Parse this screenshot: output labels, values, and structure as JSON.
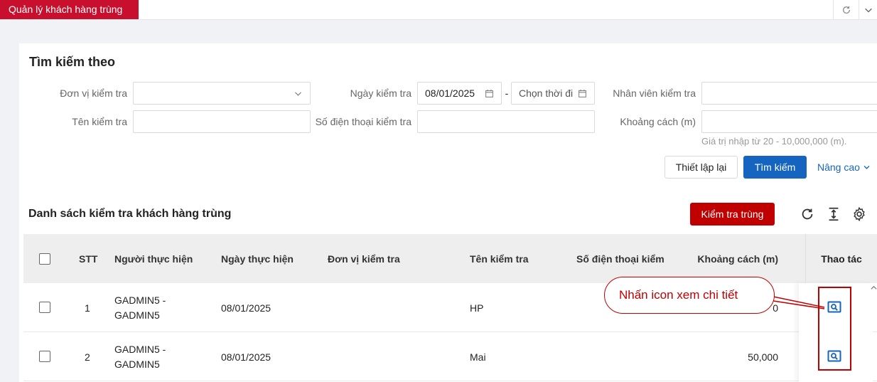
{
  "tabs": {
    "active_label": "Quản lý khách hàng trùng"
  },
  "search": {
    "title": "Tìm kiếm theo",
    "unit_label": "Đơn vị kiểm tra",
    "unit_value": "",
    "date_label": "Ngày kiểm tra",
    "date_from": "08/01/2025",
    "date_sep": "-",
    "date_to_placeholder": "Chọn thời đi",
    "staff_label": "Nhân viên kiểm tra",
    "name_label": "Tên kiểm tra",
    "phone_label": "Số điện thoại kiểm tra",
    "distance_label": "Khoảng cách (m)",
    "distance_hint": "Giá trị nhập từ 20 - 10,000,000 (m).",
    "reset_label": "Thiết lập lại",
    "search_label": "Tìm kiếm",
    "advanced_label": "Nâng cao"
  },
  "list": {
    "title": "Danh sách kiểm tra khách hàng trùng",
    "check_button": "Kiểm tra trùng",
    "columns": [
      "STT",
      "Người thực hiện",
      "Ngày thực hiện",
      "Đơn vị kiểm tra",
      "Tên kiểm tra",
      "Số điện thoại kiểm",
      "Khoảng cách (m)",
      "Thao tác"
    ],
    "rows": [
      {
        "stt": "1",
        "user_line1": "GADMIN5 -",
        "user_line2": "GADMIN5",
        "date": "08/01/2025",
        "unit": "",
        "name": "HP",
        "phone": "",
        "distance": "0"
      },
      {
        "stt": "2",
        "user_line1": "GADMIN5 -",
        "user_line2": "GADMIN5",
        "date": "08/01/2025",
        "unit": "",
        "name": "Mai",
        "phone": "",
        "distance": "50,000"
      }
    ]
  },
  "annotation": {
    "text": "Nhấn icon xem chi tiết"
  },
  "colors": {
    "brand_red": "#c8102e",
    "primary_blue": "#1565c0",
    "annotation_red": "#c00000"
  }
}
